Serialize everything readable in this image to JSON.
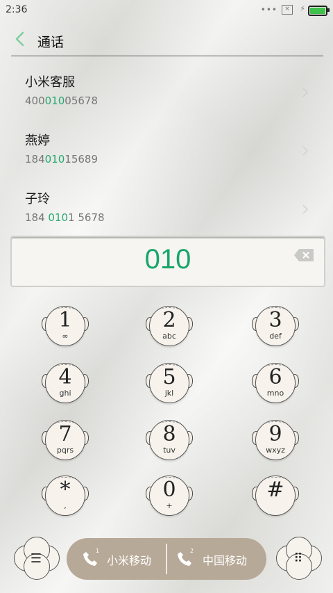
{
  "status_bar": {
    "time": "2:36",
    "dots": "•••",
    "sim": "×",
    "net": "⚡",
    "battery_level": 1.0
  },
  "header": {
    "title": "通话"
  },
  "contacts": [
    {
      "name": "小米客服",
      "num_pre": "400",
      "num_hl": "010",
      "num_post": "05678"
    },
    {
      "name": "燕婷",
      "num_pre": "184",
      "num_hl": "010",
      "num_post": "15689"
    },
    {
      "name": "子玲",
      "num_pre": "184 ",
      "num_hl": "010",
      "num_post": "1 5678"
    }
  ],
  "input": {
    "digits": "010"
  },
  "keypad": [
    {
      "num": "1",
      "sub": "∞"
    },
    {
      "num": "2",
      "sub": "abc"
    },
    {
      "num": "3",
      "sub": "def"
    },
    {
      "num": "4",
      "sub": "ghi"
    },
    {
      "num": "5",
      "sub": "jkl"
    },
    {
      "num": "6",
      "sub": "mno"
    },
    {
      "num": "7",
      "sub": "pqrs"
    },
    {
      "num": "8",
      "sub": "tuv"
    },
    {
      "num": "9",
      "sub": "wxyz"
    },
    {
      "num": "*",
      "sub": ","
    },
    {
      "num": "0",
      "sub": "+"
    },
    {
      "num": "#",
      "sub": ""
    }
  ],
  "bottom": {
    "menu_glyph": "☰",
    "dialpad_glyph": "⠿",
    "call1": {
      "label": "小米移动",
      "sim": "1"
    },
    "call2": {
      "label": "中国移动",
      "sim": "2"
    }
  },
  "colors": {
    "accent": "#27a970",
    "call_pill": "#b7a997",
    "battery": "#3fc24a"
  }
}
